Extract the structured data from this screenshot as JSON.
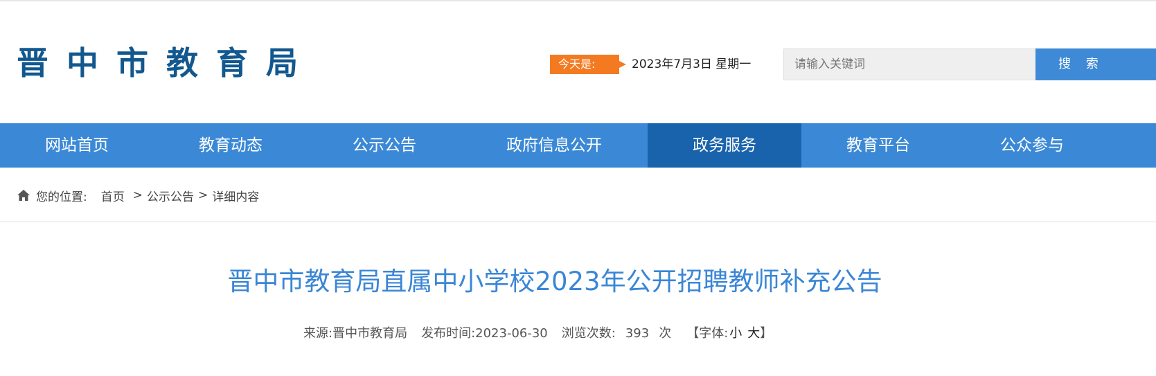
{
  "header": {
    "logo_text": "晋中市教育局",
    "date_label": "今天是:",
    "date_value": "2023年7月3日 星期一",
    "search_placeholder": "请输入关键词",
    "search_button": "搜 索"
  },
  "nav": {
    "items": [
      {
        "label": "网站首页"
      },
      {
        "label": "教育动态"
      },
      {
        "label": "公示公告"
      },
      {
        "label": "政府信息公开"
      },
      {
        "label": "政务服务",
        "active": true
      },
      {
        "label": "教育平台"
      },
      {
        "label": "公众参与"
      }
    ]
  },
  "breadcrumb": {
    "icon": "home-icon",
    "label": "您的位置:",
    "items": [
      "首页",
      "公示公告",
      "详细内容"
    ],
    "separator": ">"
  },
  "article": {
    "title": "晋中市教育局直属中小学校2023年公开招聘教师补充公告",
    "source_label": "来源:",
    "source": "晋中市教育局",
    "publish_label": "发布时间:",
    "publish_date": "2023-06-30",
    "views_label": "浏览次数:",
    "views": "393",
    "views_unit": "次",
    "font_label": "【字体:",
    "font_small": "小",
    "font_large": "大",
    "font_close": "】"
  },
  "colors": {
    "logo": "#12588f",
    "nav_bg": "#3b89d6",
    "nav_active": "#1963ac",
    "date_badge": "#f47a21",
    "title": "#3a86d6",
    "search_button": "#3e8ad6"
  }
}
